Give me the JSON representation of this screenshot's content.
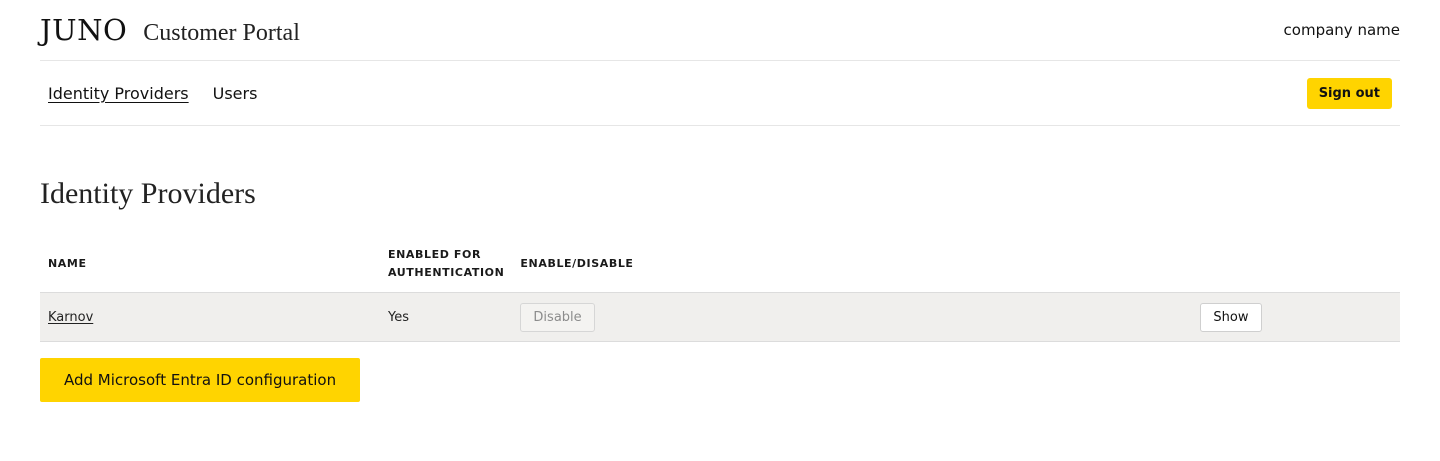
{
  "header": {
    "logo": "JUNO",
    "title": "Customer Portal",
    "company": "company name"
  },
  "nav": {
    "items": [
      {
        "label": "Identity Providers",
        "active": true
      },
      {
        "label": "Users",
        "active": false
      }
    ],
    "sign_out_label": "Sign out"
  },
  "main": {
    "heading": "Identity Providers",
    "table": {
      "columns": [
        "NAME",
        "ENABLED FOR\nAUTHENTICATION",
        "ENABLE/DISABLE",
        ""
      ],
      "col_name": "NAME",
      "col_enabled_line1": "ENABLED FOR",
      "col_enabled_line2": "AUTHENTICATION",
      "col_toggle": "ENABLE/DISABLE",
      "rows": [
        {
          "name": "Karnov",
          "enabled": "Yes",
          "toggle_label": "Disable",
          "show_label": "Show"
        }
      ]
    },
    "add_button_label": "Add Microsoft Entra ID configuration"
  },
  "colors": {
    "accent": "#ffd400",
    "row_background": "#f0efed",
    "border": "#e6e6e6"
  }
}
